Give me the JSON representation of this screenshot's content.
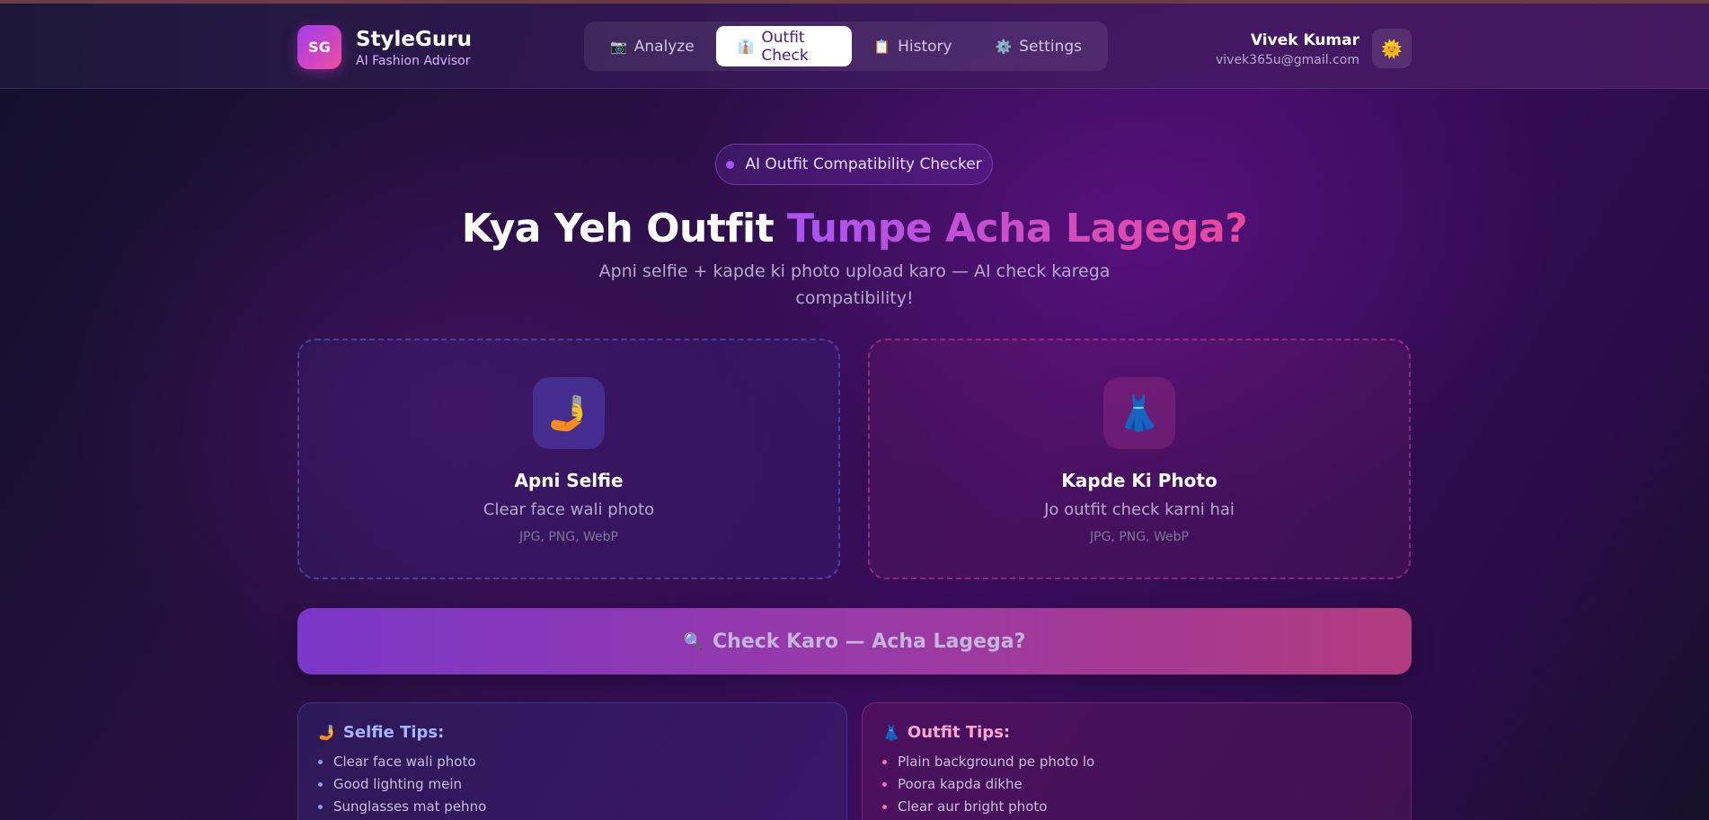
{
  "brand": {
    "logo": "SG",
    "name": "StyleGuru",
    "tagline": "AI Fashion Advisor"
  },
  "nav": {
    "tabs": [
      {
        "icon": "📷",
        "label": "Analyze",
        "active": false
      },
      {
        "icon": "👔",
        "label": "Outfit Check",
        "active": true
      },
      {
        "icon": "📋",
        "label": "History",
        "active": false
      },
      {
        "icon": "⚙️",
        "label": "Settings",
        "active": false
      }
    ]
  },
  "user": {
    "name": "Vivek Kumar",
    "email": "vivek365u@gmail.com",
    "theme_icon": "🌞"
  },
  "hero": {
    "badge": "AI Outfit Compatibility Checker",
    "headline_plain": "Kya Yeh Outfit",
    "headline_highlight": "Tumpe Acha Lagega?",
    "subtitle": "Apni selfie + kapde ki photo upload karo — AI check karega compatibility!"
  },
  "upload": {
    "selfie": {
      "icon": "🤳",
      "title": "Apni Selfie",
      "desc": "Clear face wali photo",
      "formats": "JPG, PNG, WebP"
    },
    "outfit": {
      "icon": "👗",
      "title": "Kapde Ki Photo",
      "desc": "Jo outfit check karni hai",
      "formats": "JPG, PNG, WebP"
    }
  },
  "check_button": {
    "icon": "🔍",
    "label": "Check Karo — Acha Lagega?"
  },
  "tips": {
    "selfie": {
      "icon": "🤳",
      "title": "Selfie Tips:",
      "items": [
        "Clear face wali photo",
        "Good lighting mein",
        "Sunglasses mat pehno"
      ]
    },
    "outfit": {
      "icon": "👗",
      "title": "Outfit Tips:",
      "items": [
        "Plain background pe photo lo",
        "Poora kapda dikhe",
        "Clear aur bright photo"
      ]
    }
  },
  "colors": {
    "accent_purple": "#a855f7",
    "accent_pink": "#ec4899",
    "active_tab_text": "#4a1a8a"
  }
}
